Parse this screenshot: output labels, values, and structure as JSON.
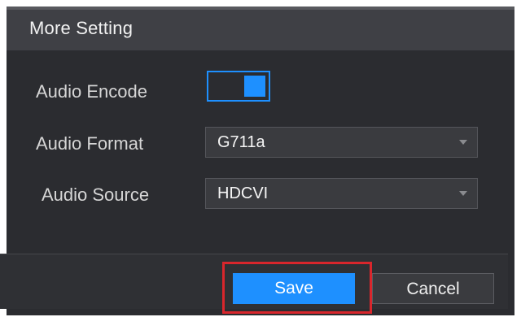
{
  "dialog": {
    "title": "More Setting"
  },
  "form": {
    "audio_encode": {
      "label": "Audio Encode",
      "enabled": true
    },
    "audio_format": {
      "label": "Audio Format",
      "value": "G711a"
    },
    "audio_source": {
      "label": "Audio Source",
      "value": "HDCVI"
    }
  },
  "footer": {
    "save_label": "Save",
    "cancel_label": "Cancel"
  },
  "colors": {
    "accent": "#1e90ff",
    "highlight": "#d9262c",
    "background": "#2b2c30"
  }
}
